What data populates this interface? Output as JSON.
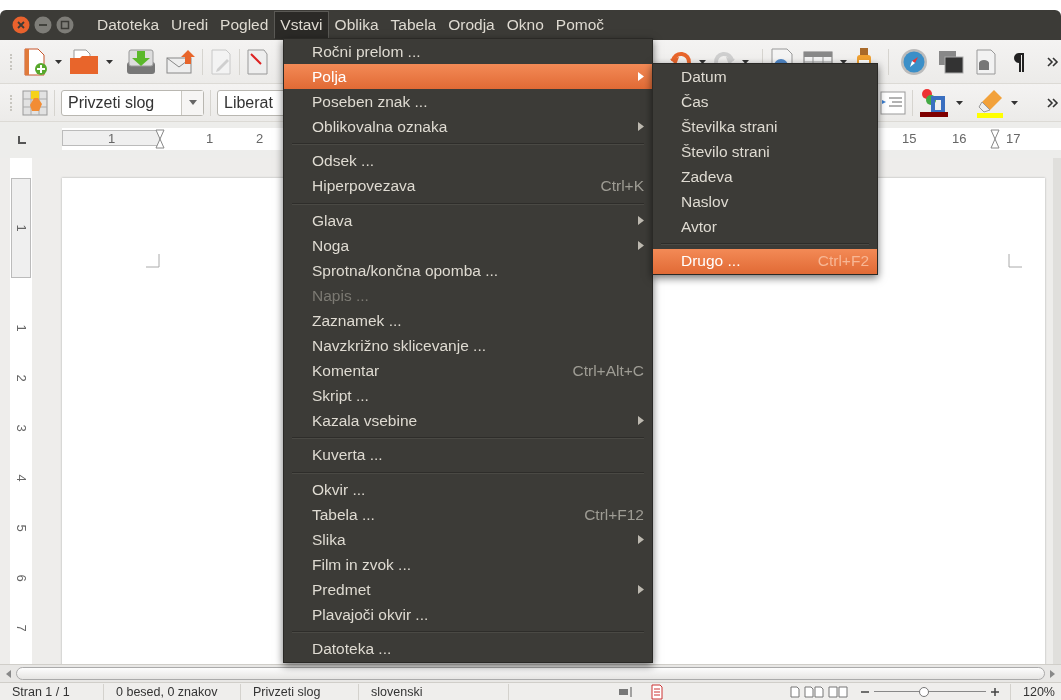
{
  "menubar": [
    {
      "label": "Datoteka",
      "selected": false
    },
    {
      "label": "Uredi",
      "selected": false
    },
    {
      "label": "Pogled",
      "selected": false
    },
    {
      "label": "Vstavi",
      "selected": true
    },
    {
      "label": "Oblika",
      "selected": false
    },
    {
      "label": "Tabela",
      "selected": false
    },
    {
      "label": "Orodja",
      "selected": false
    },
    {
      "label": "Okno",
      "selected": false
    },
    {
      "label": "Pomoč",
      "selected": false
    }
  ],
  "formatting_toolbar": {
    "paragraph_style": "Privzeti slog",
    "font_name": "Liberat"
  },
  "ruler": {
    "top_labels": [
      "1",
      "1",
      "2",
      "15",
      "16",
      "17"
    ],
    "left_labels": [
      "1",
      "1",
      "2",
      "3",
      "4",
      "5",
      "6",
      "7"
    ]
  },
  "menu": {
    "groups": [
      [
        {
          "label": "Ročni prelom ...",
          "submenu": false,
          "selected": false,
          "disabled": false
        },
        {
          "label": "Polja",
          "submenu": true,
          "selected": true,
          "disabled": false
        },
        {
          "label": "Poseben znak ...",
          "submenu": false,
          "selected": false,
          "disabled": false
        },
        {
          "label": "Oblikovalna oznaka",
          "submenu": true,
          "selected": false,
          "disabled": false
        }
      ],
      [
        {
          "label": "Odsek ...",
          "submenu": false,
          "selected": false,
          "disabled": false
        },
        {
          "label": "Hiperpovezava",
          "shortcut": "Ctrl+K",
          "submenu": false,
          "selected": false,
          "disabled": false
        }
      ],
      [
        {
          "label": "Glava",
          "submenu": true,
          "selected": false,
          "disabled": false
        },
        {
          "label": "Noga",
          "submenu": true,
          "selected": false,
          "disabled": false
        },
        {
          "label": "Sprotna/končna opomba ...",
          "submenu": false,
          "selected": false,
          "disabled": false
        },
        {
          "label": "Napis ...",
          "submenu": false,
          "selected": false,
          "disabled": true
        },
        {
          "label": "Zaznamek ...",
          "submenu": false,
          "selected": false,
          "disabled": false
        },
        {
          "label": "Navzkrižno sklicevanje ...",
          "submenu": false,
          "selected": false,
          "disabled": false
        },
        {
          "label": "Komentar",
          "shortcut": "Ctrl+Alt+C",
          "submenu": false,
          "selected": false,
          "disabled": false
        },
        {
          "label": "Skript ...",
          "submenu": false,
          "selected": false,
          "disabled": false
        },
        {
          "label": "Kazala vsebine",
          "submenu": true,
          "selected": false,
          "disabled": false
        }
      ],
      [
        {
          "label": "Kuverta ...",
          "submenu": false,
          "selected": false,
          "disabled": false
        }
      ],
      [
        {
          "label": "Okvir ...",
          "submenu": false,
          "selected": false,
          "disabled": false
        },
        {
          "label": "Tabela ...",
          "shortcut": "Ctrl+F12",
          "submenu": false,
          "selected": false,
          "disabled": false
        },
        {
          "label": "Slika",
          "submenu": true,
          "selected": false,
          "disabled": false
        },
        {
          "label": "Film in zvok ...",
          "submenu": false,
          "selected": false,
          "disabled": false
        },
        {
          "label": "Predmet",
          "submenu": true,
          "selected": false,
          "disabled": false
        },
        {
          "label": "Plavajoči okvir ...",
          "submenu": false,
          "selected": false,
          "disabled": false
        }
      ],
      [
        {
          "label": "Datoteka ...",
          "submenu": false,
          "selected": false,
          "disabled": false
        }
      ]
    ]
  },
  "submenu": {
    "groups": [
      [
        {
          "label": "Datum",
          "selected": false
        },
        {
          "label": "Čas",
          "selected": false
        },
        {
          "label": "Številka strani",
          "selected": false
        },
        {
          "label": "Število strani",
          "selected": false
        },
        {
          "label": "Zadeva",
          "selected": false
        },
        {
          "label": "Naslov",
          "selected": false
        },
        {
          "label": "Avtor",
          "selected": false
        }
      ],
      [
        {
          "label": "Drugo ...",
          "shortcut": "Ctrl+F2",
          "selected": true
        }
      ]
    ]
  },
  "status_bar": {
    "page": "Stran 1 / 1",
    "words": "0 besed, 0 znakov",
    "style": "Privzeti slog",
    "language": "slovenski",
    "zoom": {
      "level": 0.45,
      "reading": "120%"
    }
  }
}
